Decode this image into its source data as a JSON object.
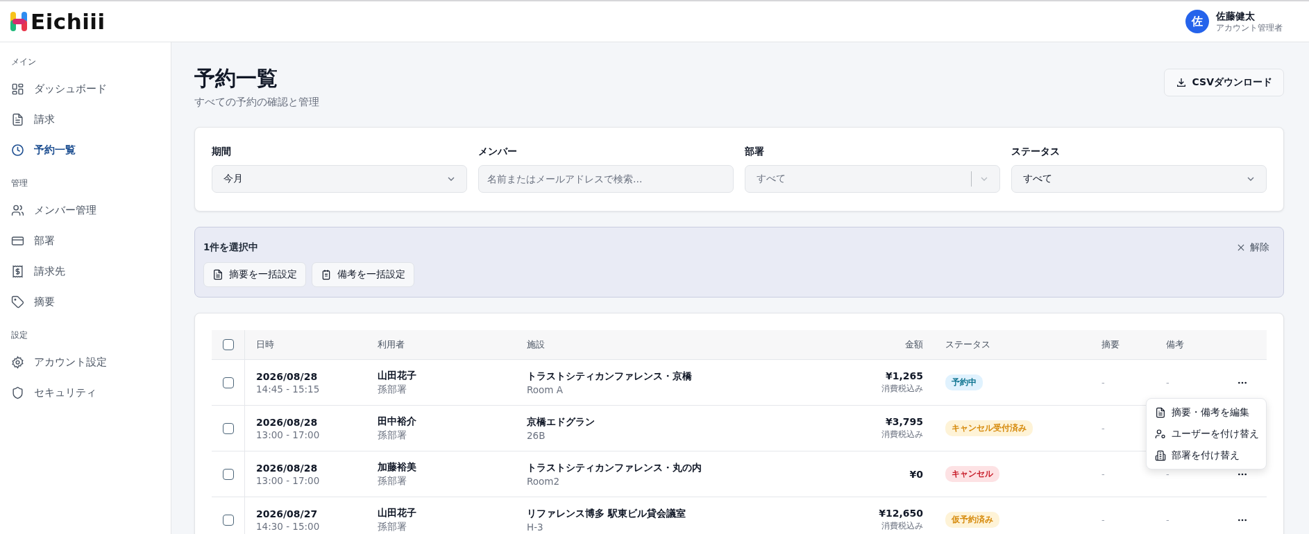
{
  "app": {
    "name": "Eichiii"
  },
  "user": {
    "initial": "佐",
    "name": "佐藤健太",
    "role": "アカウント管理者"
  },
  "sidebar": {
    "sections": [
      {
        "title": "メイン",
        "items": [
          {
            "label": "ダッシュボード",
            "selected": false
          },
          {
            "label": "請求",
            "selected": false
          },
          {
            "label": "予約一覧",
            "selected": true
          }
        ]
      },
      {
        "title": "管理",
        "items": [
          {
            "label": "メンバー管理",
            "selected": false
          },
          {
            "label": "部署",
            "selected": false
          },
          {
            "label": "請求先",
            "selected": false
          },
          {
            "label": "摘要",
            "selected": false
          }
        ]
      },
      {
        "title": "設定",
        "items": [
          {
            "label": "アカウント設定",
            "selected": false
          },
          {
            "label": "セキュリティ",
            "selected": false
          }
        ]
      }
    ]
  },
  "page": {
    "title": "予約一覧",
    "subtitle": "すべての予約の確認と管理",
    "csv_button": "CSVダウンロード"
  },
  "filters": [
    {
      "label": "期間",
      "kind": "select",
      "value": "今月",
      "disabled": false
    },
    {
      "label": "メンバー",
      "kind": "search",
      "placeholder": "名前またはメールアドレスで検索..."
    },
    {
      "label": "部署",
      "kind": "select",
      "value": "すべて",
      "disabled": true
    },
    {
      "label": "ステータス",
      "kind": "select",
      "value": "すべて",
      "disabled": false
    }
  ],
  "selection_bar": {
    "count_text": "1件を選択中",
    "clear": "解除",
    "actions": [
      "摘要を一括設定",
      "備考を一括設定"
    ]
  },
  "table": {
    "columns": [
      "日時",
      "利用者",
      "施設",
      "金額",
      "ステータス",
      "摘要",
      "備考"
    ],
    "select_all_checked": false,
    "rows": [
      {
        "checked": false,
        "date": "2026/08/28",
        "time": "14:45 - 15:15",
        "user": "山田花子",
        "department": "孫部署",
        "facility": "トラストシティカンファレンス・京橋",
        "room": "Room A",
        "amount": "¥1,265",
        "tax_note": "消費税込み",
        "status": {
          "label": "予約中",
          "kind": "reserved"
        },
        "summary": "-",
        "note": "-",
        "actions_visible": true
      },
      {
        "checked": false,
        "date": "2026/08/28",
        "time": "13:00 - 17:00",
        "user": "田中裕介",
        "department": "孫部署",
        "facility": "京橋エドグラン",
        "room": "26B",
        "amount": "¥3,795",
        "tax_note": "消費税込み",
        "status": {
          "label": "キャンセル受付済み",
          "kind": "cancel_accepted"
        },
        "summary": "-",
        "actions_visible": false
      },
      {
        "checked": false,
        "date": "2026/08/28",
        "time": "13:00 - 17:00",
        "user": "加藤裕美",
        "department": "孫部署",
        "facility": "トラストシティカンファレンス・丸の内",
        "room": "Room2",
        "amount": "¥0",
        "status": {
          "label": "キャンセル",
          "kind": "cancelled"
        },
        "summary": "-",
        "note": "-",
        "actions_visible": true
      },
      {
        "checked": false,
        "date": "2026/08/27",
        "time": "14:30 - 15:00",
        "user": "山田花子",
        "department": "孫部署",
        "facility": "リファレンス博多 駅東ビル貸会議室",
        "room": "H-3",
        "amount": "¥12,650",
        "tax_note": "消費税込み",
        "status": {
          "label": "仮予約済み",
          "kind": "tentative"
        },
        "summary": "-",
        "note": "-",
        "actions_visible": true
      }
    ]
  },
  "row_menu": [
    "摘要・備考を編集",
    "ユーザーを付け替え",
    "部署を付け替え"
  ]
}
